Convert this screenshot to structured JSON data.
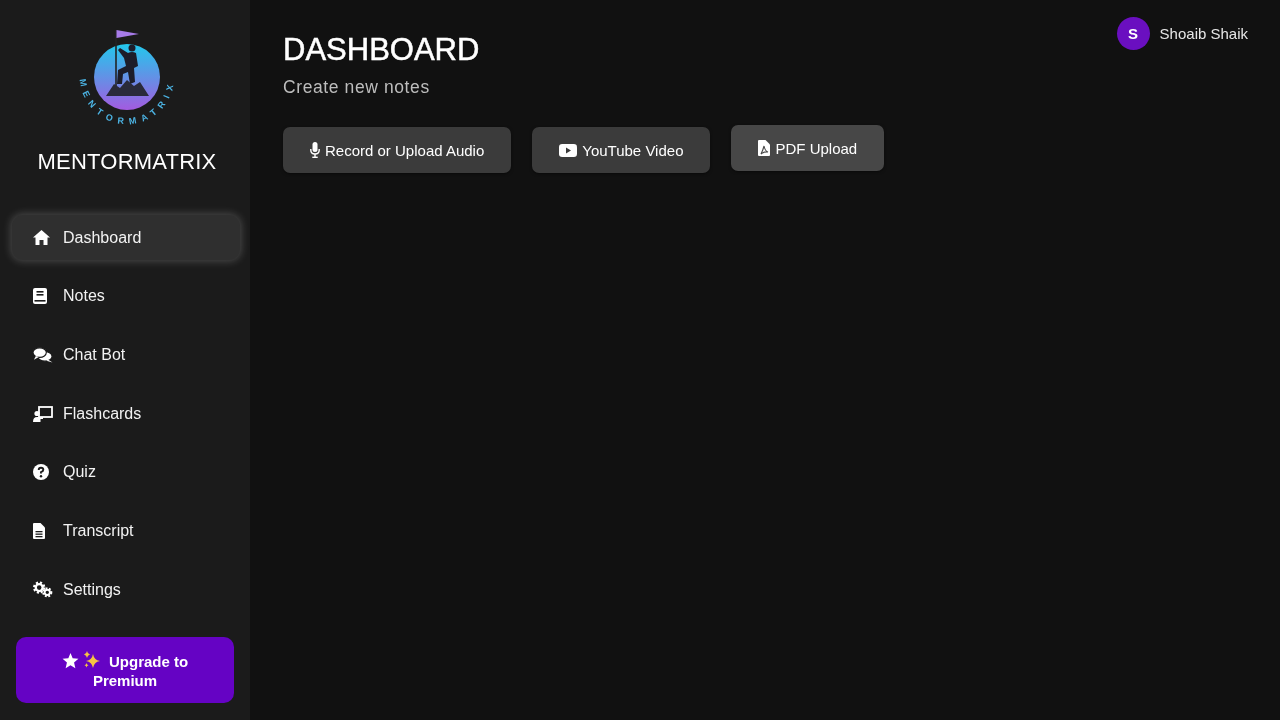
{
  "sidebar": {
    "logo": {
      "arc_text": "MENTORMATRIX"
    },
    "brand": "MENTORMATRIX",
    "items": [
      {
        "label": "Dashboard",
        "selected": true
      },
      {
        "label": "Notes",
        "selected": false
      },
      {
        "label": "Chat Bot",
        "selected": false
      },
      {
        "label": "Flashcards",
        "selected": false
      },
      {
        "label": "Quiz",
        "selected": false
      },
      {
        "label": "Transcript",
        "selected": false
      },
      {
        "label": "Settings",
        "selected": false
      }
    ],
    "upgrade_button": {
      "label": "Upgrade to Premium"
    }
  },
  "header": {
    "title": "DASHBOARD",
    "subtitle": "Create new notes"
  },
  "actions": [
    {
      "label": "Record or Upload Audio",
      "hovered": false
    },
    {
      "label": "YouTube Video",
      "hovered": false
    },
    {
      "label": "PDF Upload",
      "hovered": true
    }
  ],
  "user": {
    "initial": "S",
    "name": "Shoaib Shaik"
  }
}
